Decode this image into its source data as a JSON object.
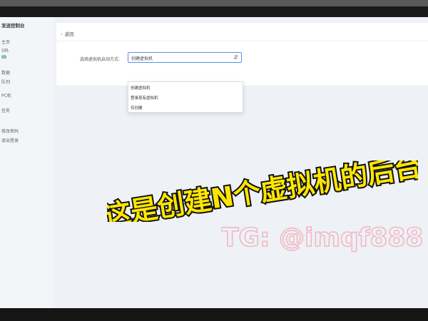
{
  "sidebar": {
    "title": "发送控制台",
    "items": [
      {
        "label": "主页",
        "active": false
      },
      {
        "label": "5码",
        "active": false
      },
      {
        "label": "ID",
        "active": true
      },
      {
        "label": "数据",
        "active": false
      },
      {
        "label": "队列",
        "active": false
      },
      {
        "label": "PC机",
        "active": false
      },
      {
        "label": "任务",
        "active": false
      },
      {
        "label": "修改密码",
        "active": false
      },
      {
        "label": "退出登录",
        "active": false
      }
    ]
  },
  "header": {
    "back_label": "返回"
  },
  "form": {
    "label": "选择虚拟机启动方式:",
    "selected": "创建虚拟机",
    "options": [
      "创建虚拟机",
      "登录现有虚拟机",
      "仅创建"
    ]
  },
  "overlay": {
    "caption": "这是创建N个虚拟机的后台",
    "watermark": "TG: @imqf888"
  },
  "colors": {
    "accent": "#18a058",
    "select_border": "#5b8def",
    "caption_fill": "#ffe600",
    "watermark": "#f2b8c3"
  }
}
